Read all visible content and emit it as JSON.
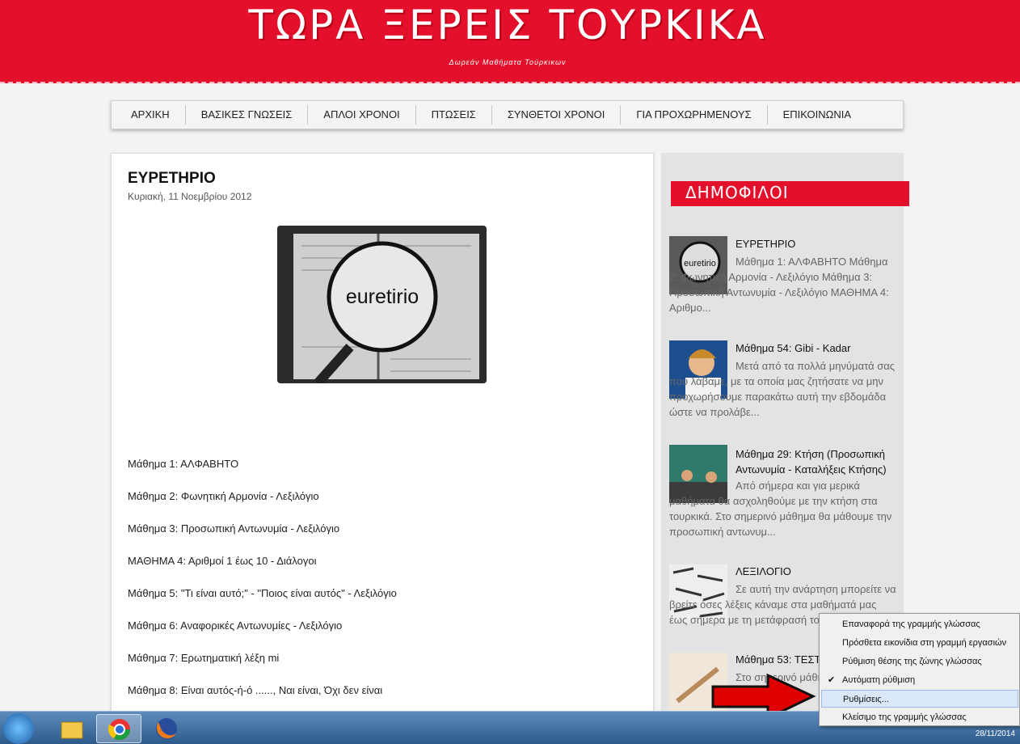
{
  "header": {
    "title": "ΤΩΡΑ ΞΕΡΕΙΣ ΤΟΥΡΚΙΚΑ",
    "subtitle": "Δωρεάν Μαθήματα Τούρκικων"
  },
  "nav": [
    "ΑΡΧΙΚΗ",
    "ΒΑΣΙΚΕΣ ΓΝΩΣΕΙΣ",
    "ΑΠΛΟΙ ΧΡΟΝΟΙ",
    "ΠΤΩΣΕΙΣ",
    "ΣΥΝΘΕΤΟΙ ΧΡΟΝΟΙ",
    "ΓΙΑ ΠΡΟΧΩΡΗΜΕΝΟΥΣ",
    "ΕΠΙΚΟΙΝΩΝΙΑ"
  ],
  "post": {
    "title": "ΕΥΡΕΤΗΡΙΟ",
    "date": "Κυριακή, 11 Νοεμβρίου 2012",
    "image_caption": "euretirio",
    "lessons": [
      "Μάθημα 1: ΑΛΦΑΒΗΤΟ",
      "Μάθημα 2: Φωνητική Αρμονία - Λεξιλόγιο",
      "Μάθημα 3: Προσωπική Αντωνυμία - Λεξιλόγιο",
      "ΜΑΘΗΜΑ 4: Αριθμοί 1 έως 10 - Διάλογοι",
      "Μάθημα 5: \"Τι είναι αυτό;\" - \"Ποιος είναι αυτός\" - Λεξιλόγιο",
      "Μάθημα 6: Αναφορικές Αντωνυμίες - Λεξιλόγιο",
      "Μάθημα 7: Ερωτηματική λέξη mi",
      "Μάθημα 8: Είναι αυτός-ή-ό ......, Ναι είναι, Όχι δεν είναι"
    ]
  },
  "sidebar": {
    "heading": "ΔΗΜΟΦΙΛΟΙ",
    "posts": [
      {
        "title": "ΕΥΡΕΤΗΡΙΟ",
        "text": "Μάθημα 1: ΑΛΦΑΒΗΤΟ Μάθημα 2: Φωνητική Αρμονία - Λεξιλόγιο Μάθημα 3: Προσωπική Αντωνυμία - Λεξιλόγιο ΜΑΘΗΜΑ 4: Αριθμο...",
        "thumb_label": "euretirio"
      },
      {
        "title": "Μάθημα 54: Gibi - Kadar",
        "text": "Μετά από τα πολλά μηνύματά σας που λάβαμε, με τα οποία μας ζητήσατε να μην προχωρήσουμε παρακάτω αυτή την εβδομάδα ώστε να προλάβε..."
      },
      {
        "title": "Μάθημα 29: Κτήση (Προσωπική Αντωνυμία - Καταλήξεις Κτήσης)",
        "text": "Από σήμερα και για μερικά μαθήματα θα ασχοληθούμε με την κτήση στα τουρκικά. Στο σημερινό μάθημα θα μάθουμε την προσωπική αντωνυμ..."
      },
      {
        "title": "ΛΕΞΙΛΟΓΙΟ",
        "text": "Σε αυτή την ανάρτηση μπορείτε να βρείτε όσες λέξεις κάναμε στα μαθήματά μας έως σήμερα με τη μετάφρασή τους: α..."
      },
      {
        "title": "Μάθημα 53: ΤΕΣΤ",
        "text": "Στο σημερινό μάθημα..."
      }
    ]
  },
  "context_menu": {
    "items": [
      "Επαναφορά της γραμμής γλώσσας",
      "Πρόσθετα εικονίδια στη γραμμή εργασιών",
      "Ρύθμιση θέσης της ζώνης γλώσσας",
      "Αυτόματη ρύθμιση",
      "Ρυθμίσεις...",
      "Κλείσιμο της γραμμής γλώσσας"
    ],
    "checked_index": 3,
    "highlighted_index": 4
  },
  "taskbar": {
    "clock_date": "28/11/2014"
  },
  "colors": {
    "brand_red": "#e4102b",
    "arrow_red": "#e00000"
  }
}
